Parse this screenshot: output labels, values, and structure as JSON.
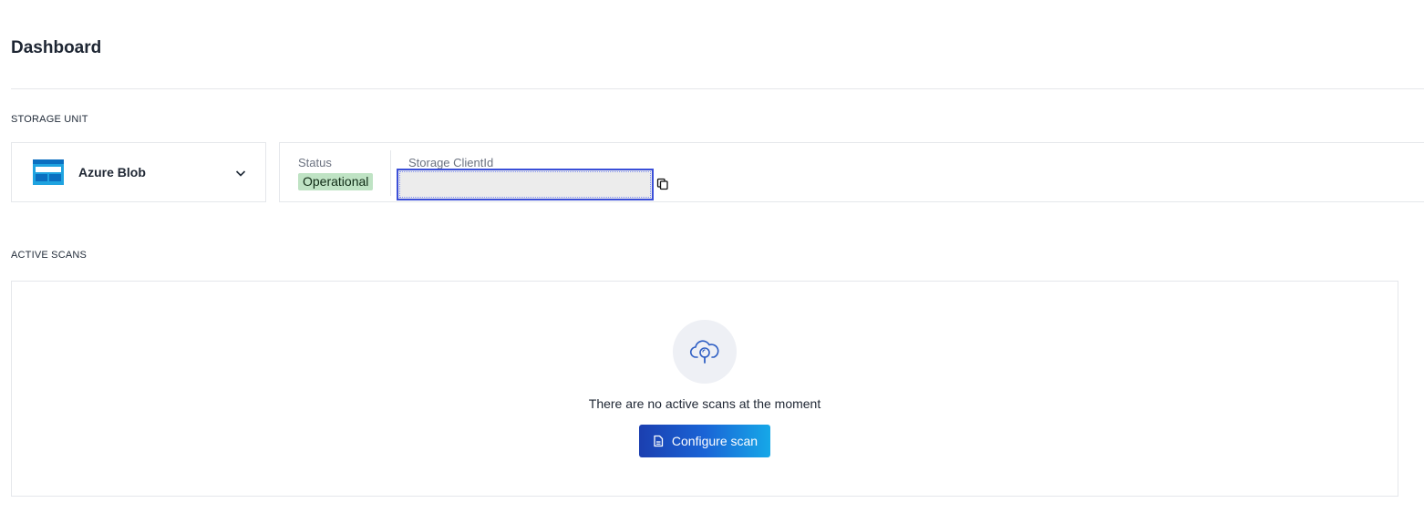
{
  "header": {
    "title": "Dashboard"
  },
  "storage_unit": {
    "section_label": "STORAGE UNIT",
    "selected": {
      "name": "Azure Blob",
      "icon": "azure-blob-icon"
    },
    "status_label": "Status",
    "status_value": "Operational",
    "client_id_label": "Storage ClientId",
    "client_id_value": ""
  },
  "active_scans": {
    "section_label": "ACTIVE SCANS",
    "empty_message": "There are no active scans at the moment",
    "empty_icon": "cloud-search-icon",
    "configure_button": "Configure scan"
  },
  "colors": {
    "accent": "#1a64d6",
    "status_badge": "#bfe3c4",
    "focus_border": "#3b4fd8"
  }
}
